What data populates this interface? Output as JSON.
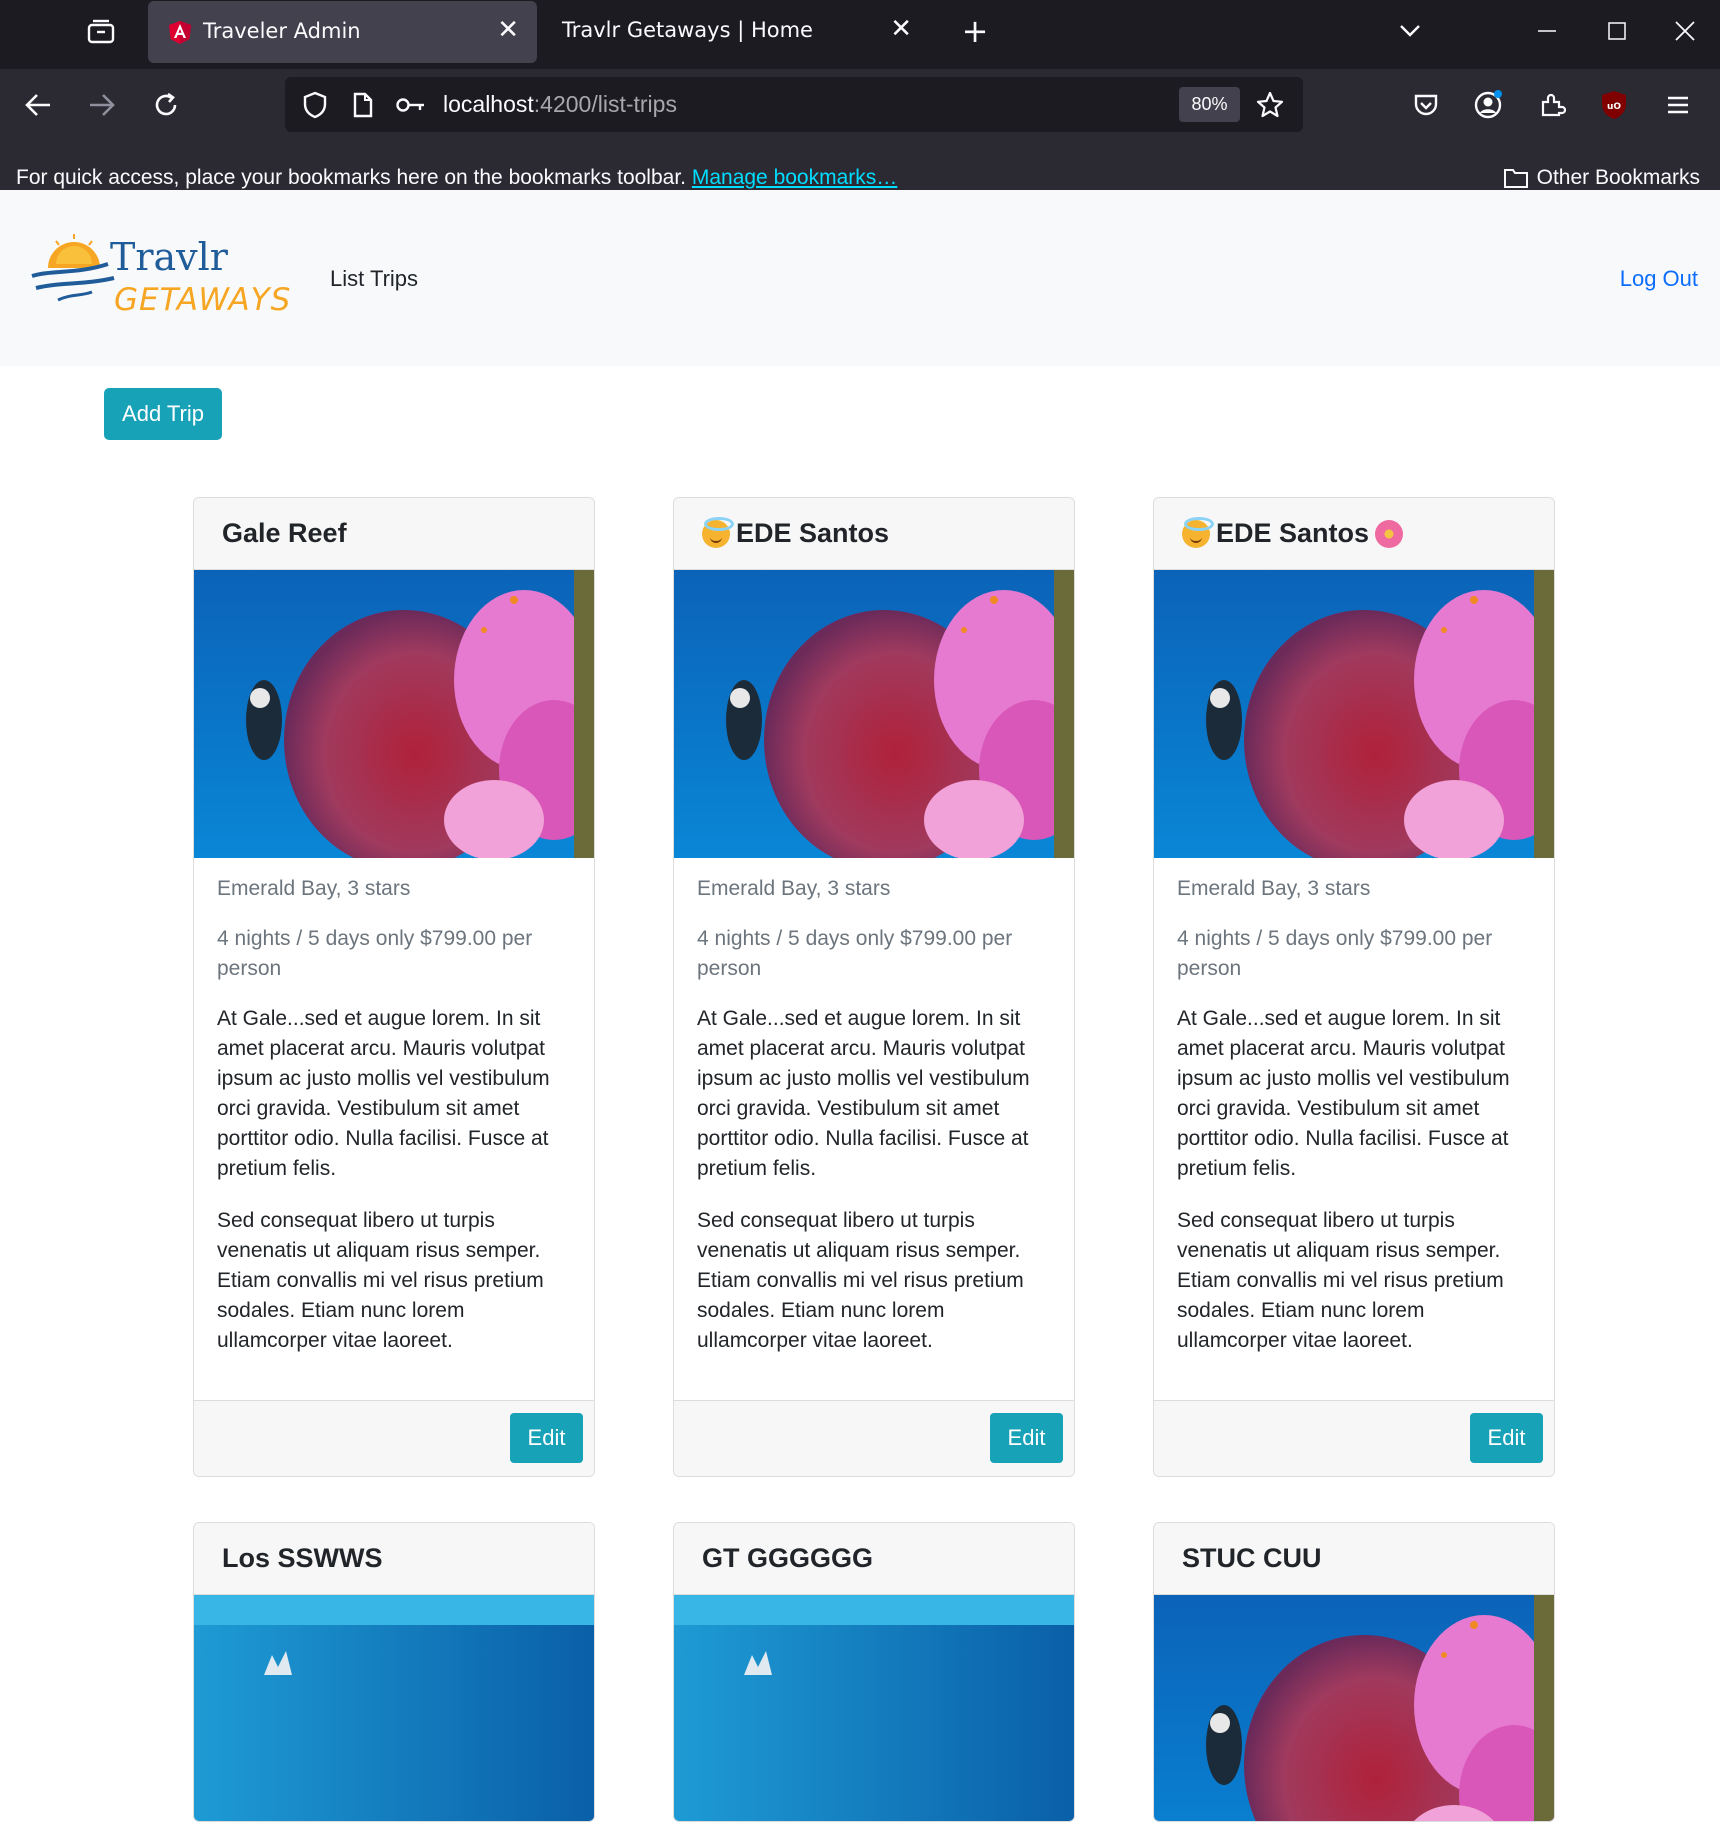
{
  "browser": {
    "tabs": [
      {
        "title": "Traveler Admin",
        "active": true
      },
      {
        "title": "Travlr Getaways | Home",
        "active": false
      }
    ],
    "url_host": "localhost",
    "url_path": ":4200/list-trips",
    "zoom": "80%",
    "bookmarks_hint": "For quick access, place your bookmarks here on the bookmarks toolbar.",
    "manage_bookmarks": "Manage bookmarks…",
    "other_bookmarks": "Other Bookmarks"
  },
  "header": {
    "brand_top": "Travlr",
    "brand_bottom": "GETAWAYS",
    "nav_link": "List Trips",
    "logout": "Log Out"
  },
  "add_trip_label": "Add Trip",
  "cards": [
    {
      "title": "Gale Reef",
      "resort": "Emerald Bay, 3 stars",
      "length_price": "4 nights / 5 days only $799.00 per person",
      "desc1": "At Gale...sed et augue lorem. In sit amet placerat arcu. Mauris volutpat ipsum ac justo mollis vel vestibulum orci gravida. Vestibulum sit amet porttitor odio. Nulla facilisi. Fusce at pretium felis.",
      "desc2": "Sed consequat libero ut turpis venenatis ut aliquam risus semper. Etiam convallis mi vel risus pretium sodales. Etiam nunc lorem ullamcorper vitae laoreet.",
      "edit": "Edit"
    },
    {
      "title": "EDE Santos",
      "resort": "Emerald Bay, 3 stars",
      "length_price": "4 nights / 5 days only $799.00 per person",
      "desc1": "At Gale...sed et augue lorem. In sit amet placerat arcu. Mauris volutpat ipsum ac justo mollis vel vestibulum orci gravida. Vestibulum sit amet porttitor odio. Nulla facilisi. Fusce at pretium felis.",
      "desc2": "Sed consequat libero ut turpis venenatis ut aliquam risus semper. Etiam convallis mi vel risus pretium sodales. Etiam nunc lorem ullamcorper vitae laoreet.",
      "edit": "Edit"
    },
    {
      "title": "EDE Santos",
      "resort": "Emerald Bay, 3 stars",
      "length_price": "4 nights / 5 days only $799.00 per person",
      "desc1": "At Gale...sed et augue lorem. In sit amet placerat arcu. Mauris volutpat ipsum ac justo mollis vel vestibulum orci gravida. Vestibulum sit amet porttitor odio. Nulla facilisi. Fusce at pretium felis.",
      "desc2": "Sed consequat libero ut turpis venenatis ut aliquam risus semper. Etiam convallis mi vel risus pretium sodales. Etiam nunc lorem ullamcorper vitae laoreet.",
      "edit": "Edit"
    },
    {
      "title": "Los SSWWS"
    },
    {
      "title": "GT GGGGGG"
    },
    {
      "title": "STUC CUU"
    }
  ],
  "colors": {
    "accent": "#17a2b8",
    "link": "#0d6efd",
    "chrome_dark": "#1c1b22",
    "chrome_toolbar": "#2b2a33"
  }
}
